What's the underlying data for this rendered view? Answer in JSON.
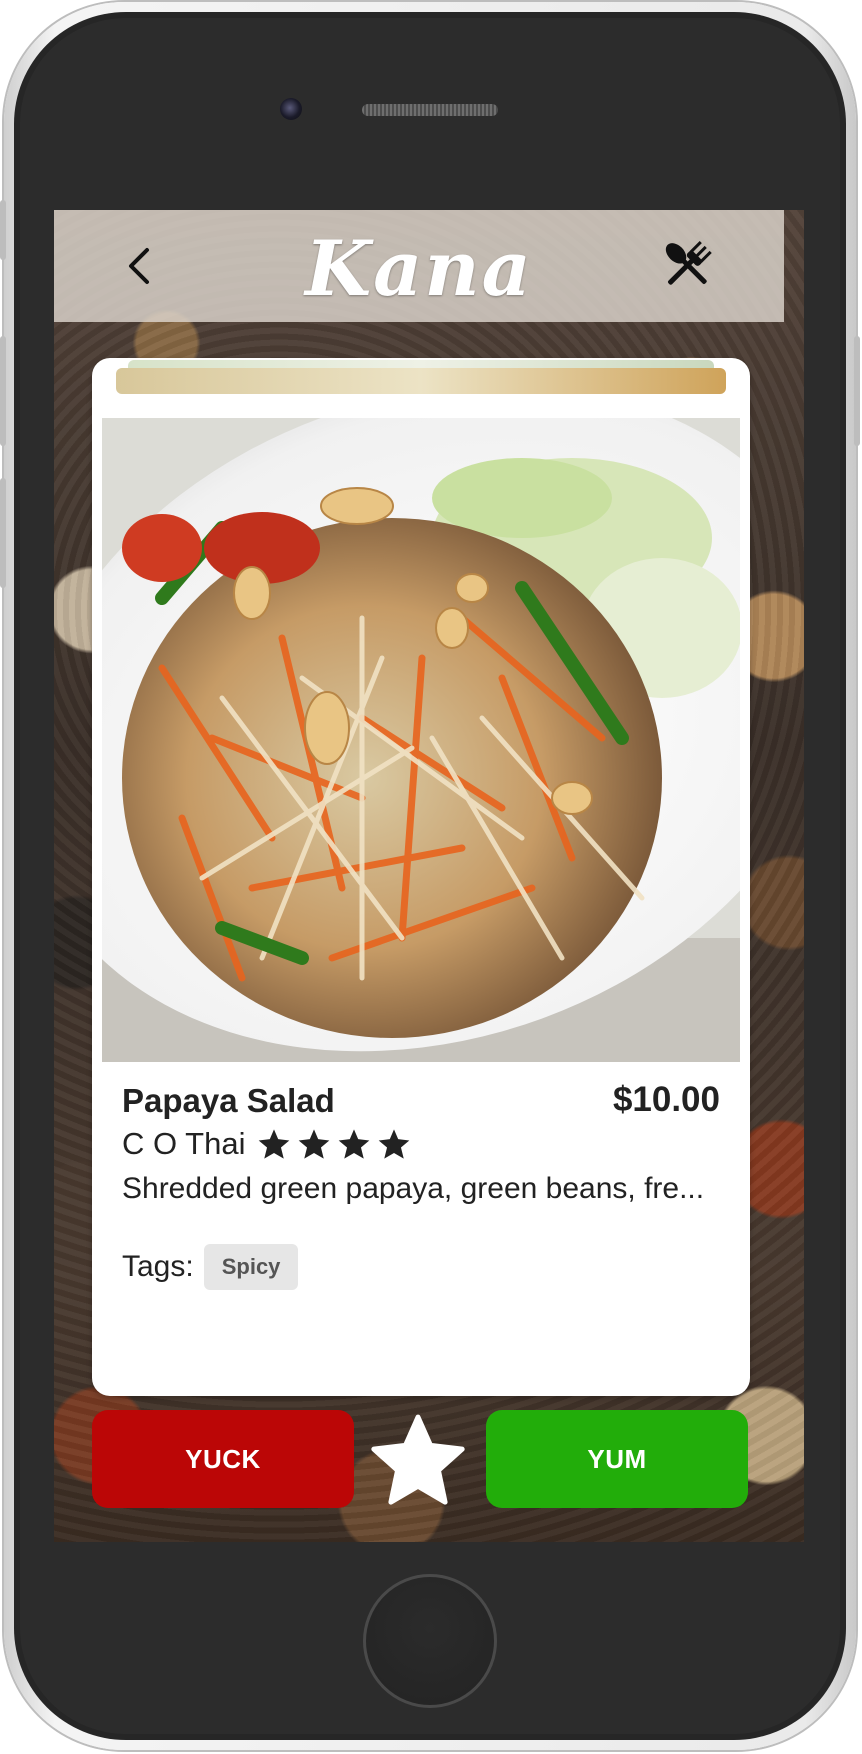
{
  "app": {
    "logo": "Kana"
  },
  "header": {
    "back_icon": "chevron-left-icon",
    "menu_icon": "fork-spoon-icon"
  },
  "dish": {
    "name": "Papaya Salad",
    "price": "$10.00",
    "restaurant": "C O Thai",
    "rating": 4,
    "description": "Shredded green papaya, green beans, fre...",
    "tags_label": "Tags:",
    "tags": [
      "Spicy"
    ]
  },
  "actions": {
    "yuck_label": "YUCK",
    "yum_label": "YUM",
    "favorite_icon": "star-icon"
  },
  "colors": {
    "yuck": "#bb0606",
    "yum": "#22ad0a"
  }
}
